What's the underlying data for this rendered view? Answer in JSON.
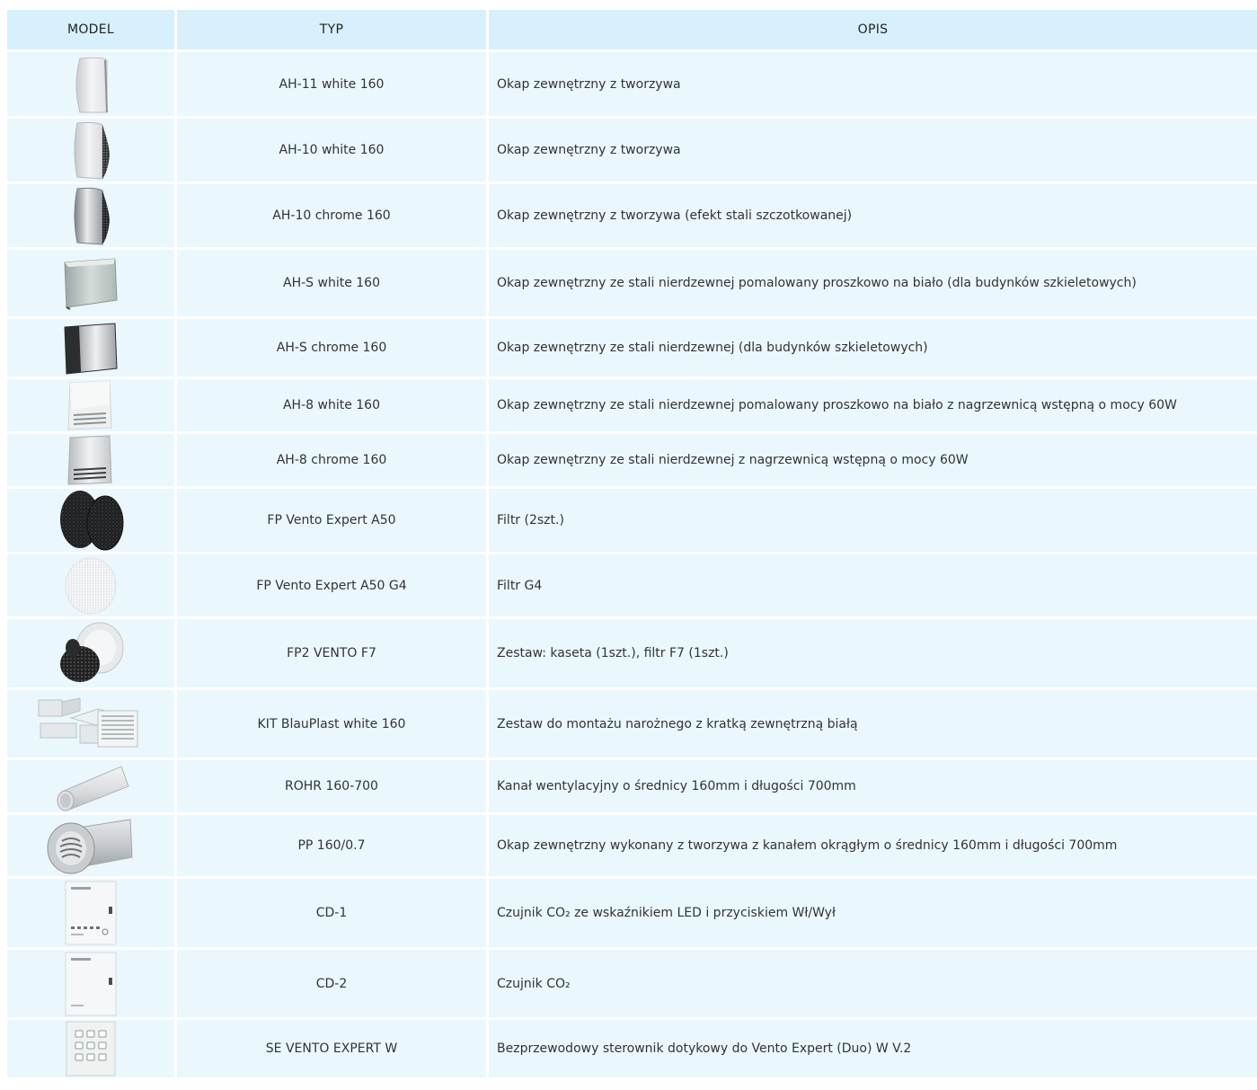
{
  "headers": {
    "model": "MODEL",
    "typ": "TYP",
    "opis": "OPIS"
  },
  "rows": [
    {
      "icon": "hood-curved-white-image",
      "typ": "AH-11 white 160",
      "opis": "Okap zewnętrzny z tworzywa"
    },
    {
      "icon": "hood-curved-grille-white-image",
      "typ": "AH-10 white 160",
      "opis": "Okap zewnętrzny z tworzywa"
    },
    {
      "icon": "hood-curved-grille-chrome-image",
      "typ": "AH-10 chrome 160",
      "opis": "Okap zewnętrzny z tworzywa (efekt stali szczotkowanej)"
    },
    {
      "icon": "hood-box-white-image",
      "typ": "AH-S white 160",
      "opis": "Okap zewnętrzny ze stali nierdzewnej pomalowany proszkowo na biało (dla budynków szkieletowych)"
    },
    {
      "icon": "hood-box-chrome-image",
      "typ": "AH-S chrome 160",
      "opis": "Okap zewnętrzny ze stali nierdzewnej  (dla budynków szkieletowych)"
    },
    {
      "icon": "hood-louvre-white-image",
      "typ": "AH-8 white 160",
      "opis": "Okap zewnętrzny ze stali nierdzewnej pomalowany proszkowo na biało z nagrzewnicą wstępną o mocy 60W"
    },
    {
      "icon": "hood-louvre-chrome-image",
      "typ": "AH-8 chrome 160",
      "opis": "Okap zewnętrzny ze stali nierdzewnej  z nagrzewnicą wstępną o mocy 60W"
    },
    {
      "icon": "filter-pads-black-image",
      "typ": "FP Vento Expert A50",
      "opis": "Filtr (2szt.)"
    },
    {
      "icon": "filter-disc-white-image",
      "typ": "FP Vento Expert A50 G4",
      "opis": "Filtr G4"
    },
    {
      "icon": "filter-cassette-image",
      "typ": "FP2 VENTO F7",
      "opis": "Zestaw: kaseta (1szt.), filtr F7 (1szt.)"
    },
    {
      "icon": "corner-mount-kit-image",
      "typ": "KIT BlauPlast white 160",
      "opis": "Zestaw do montażu narożnego z kratką zewnętrzną białą"
    },
    {
      "icon": "round-duct-image",
      "typ": "ROHR 160-700",
      "opis": "Kanał wentylacyjny o średnicy 160mm i długości 700mm"
    },
    {
      "icon": "hood-with-duct-image",
      "typ": "PP 160/0.7",
      "opis": "Okap zewnętrzny wykonany z tworzywa z kanałem okrągłym o średnicy 160mm i długości 700mm"
    },
    {
      "icon": "co2-sensor-led-image",
      "typ": "CD-1",
      "opis": "Czujnik CO₂ ze wskaźnikiem LED i przyciskiem Wł/Wył"
    },
    {
      "icon": "co2-sensor-image",
      "typ": "CD-2",
      "opis": "Czujnik CO₂"
    },
    {
      "icon": "touch-controller-image",
      "typ": "SE VENTO EXPERT W",
      "opis": "Bezprzewodowy sterownik dotykowy do Vento Expert (Duo) W V.2"
    }
  ]
}
